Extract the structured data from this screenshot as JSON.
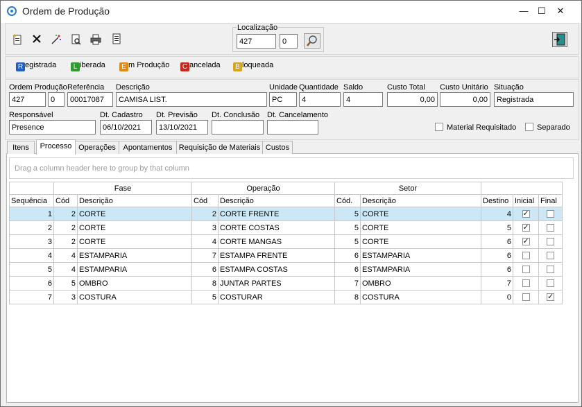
{
  "window": {
    "title": "Ordem de Produção",
    "min": "—",
    "max": "☐",
    "close": "✕"
  },
  "toolbar": {
    "icons": [
      "new-doc-icon",
      "delete-icon",
      "magic-icon",
      "preview-icon",
      "print-icon",
      "report-icon",
      "exit-icon"
    ]
  },
  "localizacao": {
    "label": "Localização",
    "value1": "427",
    "value2": "0"
  },
  "status_legend": [
    {
      "letter": "R",
      "rest": "egistrada",
      "color": "#1f5fc4"
    },
    {
      "letter": "L",
      "rest": "iberada",
      "color": "#2f9a2f"
    },
    {
      "letter": "E",
      "rest": "m Produção",
      "color": "#e08a12"
    },
    {
      "letter": "C",
      "rest": "ancelada",
      "color": "#c6271d"
    },
    {
      "letter": "B",
      "rest": "loqueada",
      "color": "#d8a520"
    }
  ],
  "fields": {
    "ordem_label": "Ordem Produção",
    "ordem_value": "427",
    "ordem_seq": "0",
    "referencia_label": "Referência",
    "referencia_value": "00017087",
    "descricao_label": "Descrição",
    "descricao_value": "CAMISA LIST.",
    "unidade_label": "Unidade",
    "unidade_value": "PC",
    "quantidade_label": "Quantidade",
    "quantidade_value": "4",
    "saldo_label": "Saldo",
    "saldo_value": "4",
    "custo_total_label": "Custo Total",
    "custo_total_value": "0,00",
    "custo_unit_label": "Custo Unitário",
    "custo_unit_value": "0,00",
    "situacao_label": "Situação",
    "situacao_value": "Registrada",
    "responsavel_label": "Responsável",
    "responsavel_value": "Presence",
    "dt_cadastro_label": "Dt. Cadastro",
    "dt_cadastro_value": "06/10/2021",
    "dt_previsao_label": "Dt. Previsão",
    "dt_previsao_value": "13/10/2021",
    "dt_conclusao_label": "Dt. Conclusão",
    "dt_conclusao_value": "",
    "dt_cancel_label": "Dt. Cancelamento",
    "dt_cancel_value": "",
    "material_req_label": "Material Requisitado",
    "separado_label": "Separado"
  },
  "tabs": [
    "Itens",
    "Processo",
    "Operações",
    "Apontamentos",
    "Requisição de Materiais",
    "Custos"
  ],
  "active_tab": "Processo",
  "grid": {
    "group_hint": "Drag a column header here to group by that column",
    "bands": {
      "fase": "Fase",
      "operacao": "Operação",
      "setor": "Setor"
    },
    "columns": {
      "sequencia": "Sequência",
      "fase_cod": "Cód",
      "fase_desc": "Descrição",
      "op_cod": "Cód",
      "op_desc": "Descrição",
      "setor_cod": "Cód.",
      "setor_desc": "Descrição",
      "destino": "Destino",
      "inicial": "Inicial",
      "final": "Final"
    },
    "rows": [
      {
        "seq": "1",
        "fase_cod": "2",
        "fase_desc": "CORTE",
        "op_cod": "2",
        "op_desc": "CORTE FRENTE",
        "setor_cod": "5",
        "setor_desc": "CORTE",
        "destino": "4",
        "inicial": true,
        "final": false
      },
      {
        "seq": "2",
        "fase_cod": "2",
        "fase_desc": "CORTE",
        "op_cod": "3",
        "op_desc": "CORTE COSTAS",
        "setor_cod": "5",
        "setor_desc": "CORTE",
        "destino": "5",
        "inicial": true,
        "final": false
      },
      {
        "seq": "3",
        "fase_cod": "2",
        "fase_desc": "CORTE",
        "op_cod": "4",
        "op_desc": "CORTE MANGAS",
        "setor_cod": "5",
        "setor_desc": "CORTE",
        "destino": "6",
        "inicial": true,
        "final": false
      },
      {
        "seq": "4",
        "fase_cod": "4",
        "fase_desc": "ESTAMPARIA",
        "op_cod": "7",
        "op_desc": "ESTAMPA FRENTE",
        "setor_cod": "6",
        "setor_desc": "ESTAMPARIA",
        "destino": "6",
        "inicial": false,
        "final": false
      },
      {
        "seq": "5",
        "fase_cod": "4",
        "fase_desc": "ESTAMPARIA",
        "op_cod": "6",
        "op_desc": "ESTAMPA COSTAS",
        "setor_cod": "6",
        "setor_desc": "ESTAMPARIA",
        "destino": "6",
        "inicial": false,
        "final": false
      },
      {
        "seq": "6",
        "fase_cod": "5",
        "fase_desc": "OMBRO",
        "op_cod": "8",
        "op_desc": "JUNTAR PARTES",
        "setor_cod": "7",
        "setor_desc": "OMBRO",
        "destino": "7",
        "inicial": false,
        "final": false
      },
      {
        "seq": "7",
        "fase_cod": "3",
        "fase_desc": "COSTURA",
        "op_cod": "5",
        "op_desc": "COSTURAR",
        "setor_cod": "8",
        "setor_desc": "COSTURA",
        "destino": "0",
        "inicial": false,
        "final": true
      }
    ]
  }
}
